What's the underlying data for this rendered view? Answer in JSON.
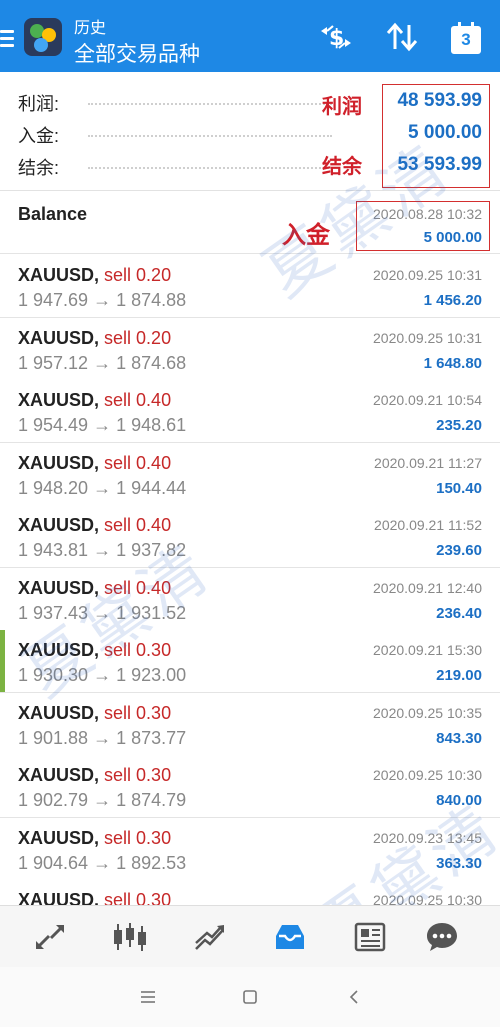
{
  "header": {
    "subtitle": "历史",
    "title": "全部交易品种",
    "calendar_day": "3"
  },
  "summary": {
    "profit_label": "利润:",
    "profit_value": "48 593.99",
    "deposit_label": "入金:",
    "deposit_value": "5 000.00",
    "balance_label": "结余:",
    "balance_value": "53 593.99"
  },
  "annotations": {
    "profit": "利润",
    "balance": "结余",
    "deposit": "入金"
  },
  "balance_entry": {
    "label": "Balance",
    "time": "2020.08.28 10:32",
    "amount": "5 000.00"
  },
  "trades": [
    {
      "symbol": "XAUUSD,",
      "side": "sell 0.20",
      "prices": "1 947.69 → 1 874.88",
      "time": "2020.09.25 10:31",
      "profit": "1 456.20"
    },
    {
      "symbol": "XAUUSD,",
      "side": "sell 0.20",
      "prices": "1 957.12 → 1 874.68",
      "time": "2020.09.25 10:31",
      "profit": "1 648.80"
    },
    {
      "symbol": "XAUUSD,",
      "side": "sell 0.40",
      "prices": "1 954.49 → 1 948.61",
      "time": "2020.09.21 10:54",
      "profit": "235.20"
    },
    {
      "symbol": "XAUUSD,",
      "side": "sell 0.40",
      "prices": "1 948.20 → 1 944.44",
      "time": "2020.09.21 11:27",
      "profit": "150.40"
    },
    {
      "symbol": "XAUUSD,",
      "side": "sell 0.40",
      "prices": "1 943.81 → 1 937.82",
      "time": "2020.09.21 11:52",
      "profit": "239.60"
    },
    {
      "symbol": "XAUUSD,",
      "side": "sell 0.40",
      "prices": "1 937.43 → 1 931.52",
      "time": "2020.09.21 12:40",
      "profit": "236.40"
    },
    {
      "symbol": "XAUUSD,",
      "side": "sell 0.30",
      "prices": "1 930.30 → 1 923.00",
      "time": "2020.09.21 15:30",
      "profit": "219.00"
    },
    {
      "symbol": "XAUUSD,",
      "side": "sell 0.30",
      "prices": "1 901.88 → 1 873.77",
      "time": "2020.09.25 10:35",
      "profit": "843.30"
    },
    {
      "symbol": "XAUUSD,",
      "side": "sell 0.30",
      "prices": "1 902.79 → 1 874.79",
      "time": "2020.09.25 10:30",
      "profit": "840.00"
    },
    {
      "symbol": "XAUUSD,",
      "side": "sell 0.30",
      "prices": "1 904.64 → 1 892.53",
      "time": "2020.09.23 13:45",
      "profit": "363.30"
    },
    {
      "symbol": "XAUUSD,",
      "side": "sell 0.30",
      "prices": "",
      "time": "2020.09.25 10:30",
      "profit": ""
    }
  ],
  "watermark": "夏黛清",
  "bottom_nav": [
    "quotes-icon",
    "chart-icon",
    "trade-icon",
    "history-icon",
    "news-icon",
    "chat-icon"
  ],
  "colors": {
    "header": "#1e88e5",
    "profit": "#1c6fc4",
    "sell": "#c62828",
    "annotation": "#d32f2f"
  }
}
